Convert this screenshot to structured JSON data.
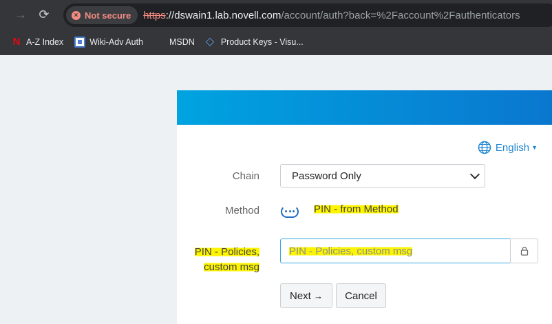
{
  "browser": {
    "security_label": "Not secure",
    "url_scheme": "https",
    "url_sep": "://",
    "url_host": "dswain1.lab.novell.com",
    "url_path": "/account/auth?back=%2Faccount%2Fauthenticators"
  },
  "bookmarks": [
    {
      "label": "A-Z Index",
      "icon": "netflix-n-icon"
    },
    {
      "label": "Wiki-Adv Auth",
      "icon": "wiki-icon"
    },
    {
      "label": "MSDN",
      "icon": "microsoft-logo-icon"
    },
    {
      "label": "Product Keys - Visu...",
      "icon": "visual-studio-icon"
    }
  ],
  "login": {
    "language": "English",
    "chain_label": "Chain",
    "chain_value": "Password Only",
    "method_label": "Method",
    "method_value": "PIN - from Method",
    "pin_label_line1": "PIN - Policies,",
    "pin_label_line2": "custom msg",
    "pin_placeholder": "PIN - Policies, custom msg",
    "next_label": "Next",
    "next_arrow": "→",
    "cancel_label": "Cancel"
  },
  "colors": {
    "header_start": "#00a3e0",
    "header_end": "#0a77cf",
    "highlight": "#fcf400",
    "link": "#1f86d0"
  }
}
